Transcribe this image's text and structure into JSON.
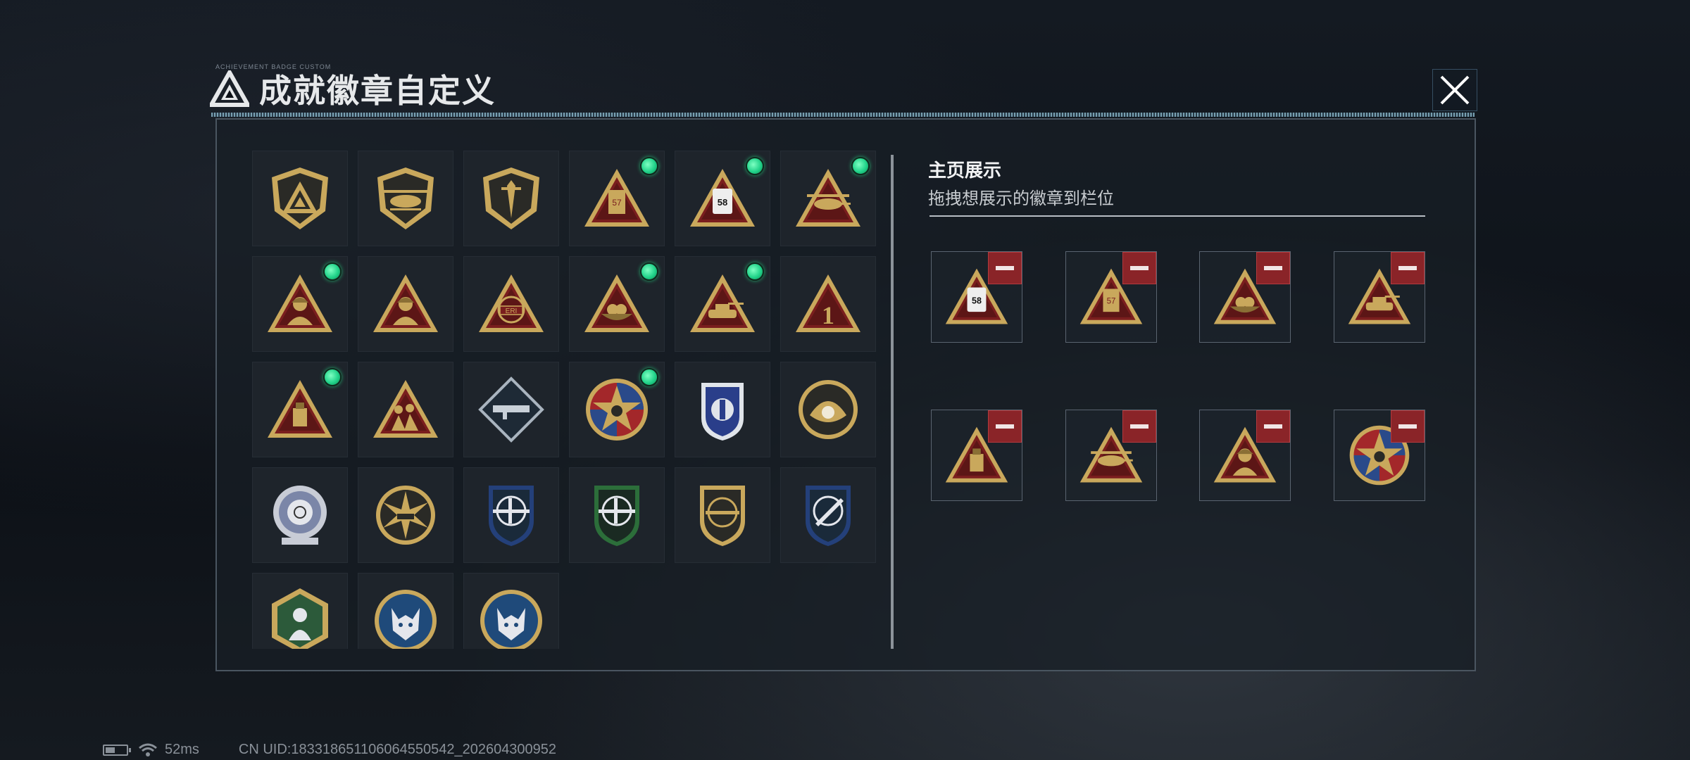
{
  "header": {
    "small_caption": "ACHIEVEMENT BADGE CUSTOM",
    "title": "成就徽章自定义",
    "logo_icon": "triangle-emblem-icon",
    "close_icon": "close-icon"
  },
  "badge_grid": {
    "badges": [
      {
        "icon": "triangle-shield-badge-icon",
        "new": false,
        "style": "shield-tri"
      },
      {
        "icon": "helicopter-shield-badge-icon",
        "new": false,
        "style": "shield-heli"
      },
      {
        "icon": "dagger-shield-badge-icon",
        "new": false,
        "style": "shield-dagger"
      },
      {
        "icon": "card-57-badge-icon",
        "new": true,
        "style": "tri-card57"
      },
      {
        "icon": "ticket-58-badge-icon",
        "new": true,
        "style": "tri-ticket58"
      },
      {
        "icon": "helicopter-badge-icon",
        "new": true,
        "style": "tri-heli"
      },
      {
        "icon": "soldier-helmet-badge-icon",
        "new": true,
        "style": "tri-soldier"
      },
      {
        "icon": "soldier-badge-icon",
        "new": false,
        "style": "tri-soldier"
      },
      {
        "icon": "eri-globe-badge-icon",
        "new": false,
        "style": "tri-eri"
      },
      {
        "icon": "bird-nest-badge-icon",
        "new": true,
        "style": "tri-nest"
      },
      {
        "icon": "tank-badge-icon",
        "new": true,
        "style": "tri-tank"
      },
      {
        "icon": "number-one-badge-icon",
        "new": false,
        "style": "tri-one"
      },
      {
        "icon": "usb-drive-badge-icon",
        "new": true,
        "style": "tri-usb"
      },
      {
        "icon": "squad-badge-icon",
        "new": false,
        "style": "tri-squad"
      },
      {
        "icon": "rocket-launcher-badge-icon",
        "new": false,
        "style": "diamond-rocket"
      },
      {
        "icon": "star-skull-badge-icon",
        "new": true,
        "style": "round-star"
      },
      {
        "icon": "blue-shield-badge-icon",
        "new": false,
        "style": "blue-shield"
      },
      {
        "icon": "pearl-shell-badge-icon",
        "new": false,
        "style": "round-pearl"
      },
      {
        "icon": "crosshair-skull-badge-icon",
        "new": false,
        "style": "silver-skull"
      },
      {
        "icon": "tank-burst-badge-icon",
        "new": false,
        "style": "round-burst"
      },
      {
        "icon": "rifle-crosshair-blue-badge-icon",
        "new": false,
        "style": "shield-blue-rifle"
      },
      {
        "icon": "rifle-crosshair-green-badge-icon",
        "new": false,
        "style": "shield-green-rifle"
      },
      {
        "icon": "rifle-gold-shield-badge-icon",
        "new": false,
        "style": "shield-gold-rifle"
      },
      {
        "icon": "knife-crosshair-badge-icon",
        "new": false,
        "style": "shield-blue-knife"
      },
      {
        "icon": "hex-soldier-badge-icon",
        "new": false,
        "style": "hex-green"
      },
      {
        "icon": "wolf-badge-icon",
        "new": false,
        "style": "round-wolf"
      },
      {
        "icon": "wolf-badge-icon",
        "new": false,
        "style": "round-wolf"
      }
    ]
  },
  "showcase": {
    "title": "主页展示",
    "subtitle": "拖拽想展示的徽章到栏位",
    "slots": [
      {
        "icon": "ticket-58-badge-icon",
        "style": "tri-ticket58"
      },
      {
        "icon": "card-57-badge-icon",
        "style": "tri-card57"
      },
      {
        "icon": "bird-nest-badge-icon",
        "style": "tri-nest"
      },
      {
        "icon": "tank-badge-icon",
        "style": "tri-tank"
      },
      {
        "icon": "usb-drive-badge-icon",
        "style": "tri-usb"
      },
      {
        "icon": "helicopter-badge-icon",
        "style": "tri-heli"
      },
      {
        "icon": "soldier-helmet-badge-icon",
        "style": "tri-soldier"
      },
      {
        "icon": "star-skull-badge-icon",
        "style": "round-star"
      }
    ],
    "remove_icon": "minus-icon"
  },
  "footer": {
    "battery_level": 0.45,
    "ping": "52ms",
    "uid": "CN UID:18331865110606455054​2_202604300952"
  },
  "colors": {
    "accent_gold": "#c9a85c",
    "badge_red": "#7a1e1e",
    "new_dot": "#22d38a",
    "remove_red": "#8a2428"
  }
}
